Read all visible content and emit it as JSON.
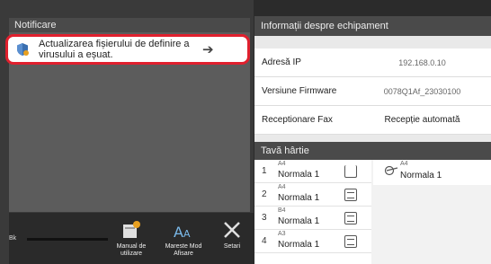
{
  "notifications": {
    "header": "Notificare",
    "message": "Actualizarea fișierului de definire a virusului a eșuat."
  },
  "toolbar": {
    "bk_label": "Bk",
    "items": [
      {
        "label": "Manual de utilizare"
      },
      {
        "label": "Mareste Mod Afisare"
      },
      {
        "label": "Setari"
      }
    ]
  },
  "equipment": {
    "header": "Informații despre echipament",
    "rows": [
      {
        "label": "Adresă IP",
        "value": "192.168.0.10"
      },
      {
        "label": "Versiune Firmware",
        "value": "0078Q1Af_23030100"
      },
      {
        "label": "Receptionare Fax",
        "value": "Recepție automată"
      }
    ]
  },
  "trays": {
    "header": "Tavă hârtie",
    "items": [
      {
        "num": "1",
        "size": "A4",
        "type": "Normala 1"
      },
      {
        "num": "2",
        "size": "A4",
        "type": "Normala 1"
      },
      {
        "num": "3",
        "size": "B4",
        "type": "Normala 1"
      },
      {
        "num": "4",
        "size": "A3",
        "type": "Normala 1"
      }
    ],
    "bypass": {
      "size": "A4",
      "type": "Normala 1"
    }
  }
}
